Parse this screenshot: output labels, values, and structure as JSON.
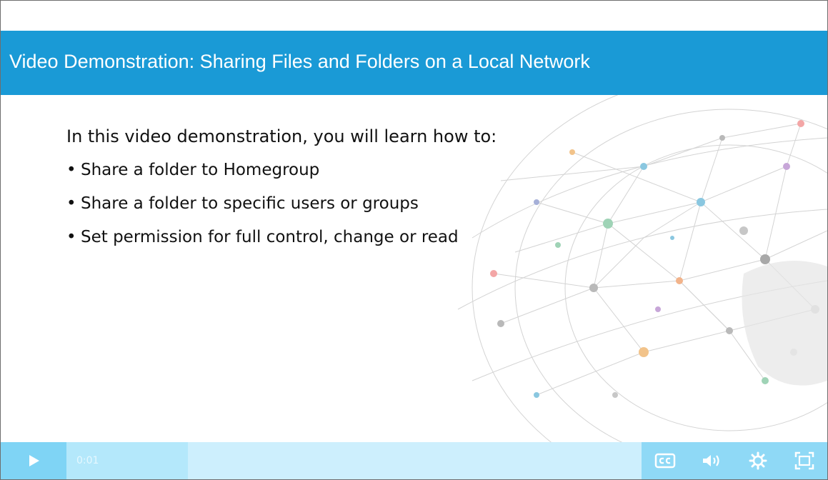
{
  "slide": {
    "title": "Video Demonstration: Sharing Files and Folders on a Local Network",
    "intro": "In this video demonstration, you will learn how to:",
    "bullets": [
      "Share a folder to Homegroup",
      "Share a folder to specific users or groups",
      "Set permission for full control, change or read"
    ],
    "bullet_glyph": "•"
  },
  "player": {
    "time": "0:01",
    "progress_fraction": 0.15,
    "icons": [
      "play-icon",
      "closed-captions-icon",
      "volume-icon",
      "settings-icon",
      "fullscreen-icon"
    ],
    "colors": {
      "title_bar": "#1a9ad6",
      "control_bar": "#cdeffd",
      "control_accent": "#8fd9f6"
    }
  }
}
